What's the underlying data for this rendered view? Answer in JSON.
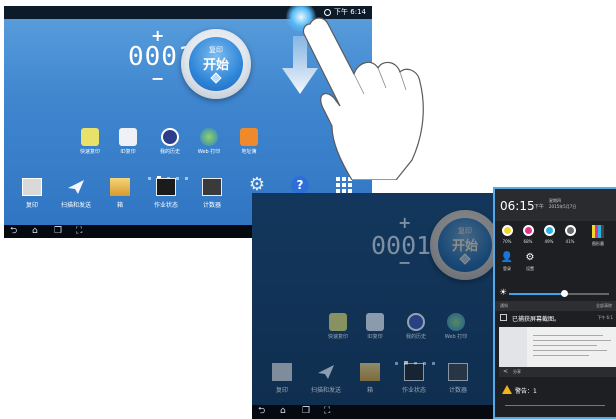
{
  "screen1": {
    "status_time": "下午 6:14",
    "copy_count": "0001",
    "plus_label": "+",
    "minus_label": "−",
    "start_label_top": "复印",
    "start_label_main": "开始",
    "apps": [
      {
        "label": "快速复印",
        "icon": "quick-copy-icon"
      },
      {
        "label": "ID复印",
        "icon": "id-copy-icon"
      },
      {
        "label": "我的历史",
        "icon": "my-history-icon"
      },
      {
        "label": "Web 打印",
        "icon": "web-print-icon"
      },
      {
        "label": "地址簿",
        "icon": "address-book-icon"
      }
    ],
    "dock": [
      {
        "label": "复印",
        "icon": "copy-icon"
      },
      {
        "label": "扫描和发送",
        "icon": "scan-send-icon"
      },
      {
        "label": "箱",
        "icon": "box-icon"
      },
      {
        "label": "作业状态",
        "icon": "job-status-icon"
      },
      {
        "label": "计数器",
        "icon": "counter-icon"
      },
      {
        "label": "",
        "icon": "settings-icon"
      },
      {
        "label": "",
        "icon": "help-icon"
      },
      {
        "label": "",
        "icon": "all-apps-icon"
      }
    ]
  },
  "screen2": {
    "copy_count": "0001",
    "plus_label": "+",
    "minus_label": "−",
    "start_label_top": "复印",
    "start_label_main": "开始",
    "apps": [
      {
        "label": "快速复印"
      },
      {
        "label": "ID复印"
      },
      {
        "label": "我的历史"
      },
      {
        "label": "Web 打印"
      }
    ],
    "dock": [
      {
        "label": "复印"
      },
      {
        "label": "扫描和发送"
      },
      {
        "label": "箱"
      },
      {
        "label": "作业状态"
      },
      {
        "label": "计数器"
      }
    ]
  },
  "panel": {
    "time": "06:15",
    "ampm": "下午",
    "weekday": "星期四",
    "date": "2015年5月7日",
    "inks": [
      {
        "color": "#f0d82c",
        "percent": "70%"
      },
      {
        "color": "#e2358a",
        "percent": "68%"
      },
      {
        "color": "#2ab4e6",
        "percent": "49%"
      },
      {
        "color": "#6b6b6b",
        "percent": "41%"
      }
    ],
    "ink_more": "图形墨",
    "quick": [
      {
        "label": "登录",
        "icon": "user-icon"
      },
      {
        "label": "设置",
        "icon": "gear-icon"
      }
    ],
    "brightness": 0.55,
    "section_label": "通知",
    "section_action": "全部清除",
    "notification_title": "已捕获屏幕截图。",
    "notification_time": "下午 6:1",
    "share_label": "分享",
    "warning_text": "警告：1"
  }
}
